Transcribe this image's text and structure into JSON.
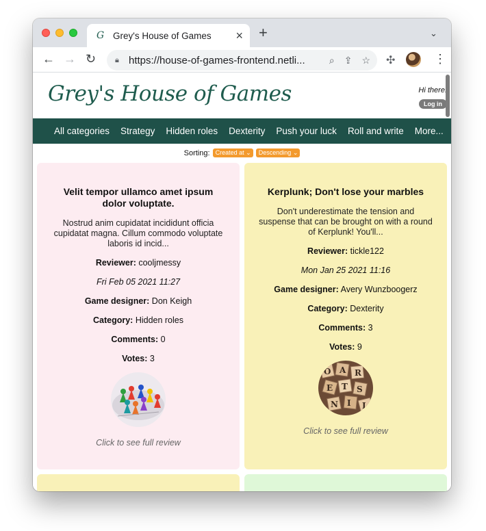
{
  "browser": {
    "tab_title": "Grey's House of Games",
    "url": "https://house-of-games-frontend.netli..."
  },
  "site": {
    "logo": "Grey's House of Games",
    "greeting": "Hi there!",
    "login_label": "Log in",
    "nav": [
      "All categories",
      "Strategy",
      "Hidden roles",
      "Dexterity",
      "Push your luck",
      "Roll and write",
      "More..."
    ],
    "sorting": {
      "label": "Sorting:",
      "sort_by": "Created at",
      "order": "Descending"
    }
  },
  "labels": {
    "reviewer": "Reviewer:",
    "designer": "Game designer:",
    "category": "Category:",
    "comments": "Comments:",
    "votes": "Votes:",
    "cta": "Click to see full review"
  },
  "reviews": [
    {
      "title": "Velit tempor ullamco amet ipsum dolor voluptate.",
      "body": "Nostrud anim cupidatat incididunt officia cupidatat magna. Cillum commodo voluptate laboris id incid...",
      "reviewer": "cooljmessy",
      "date": "Fri Feb 05 2021 11:27",
      "designer": "Don Keigh",
      "category": "Hidden roles",
      "comments": "0",
      "votes": "3",
      "background": "#fdecf1"
    },
    {
      "title": "Kerplunk; Don't lose your marbles",
      "body": "Don't underestimate the tension and suspense that can be brought on with a round of Kerplunk! You'll...",
      "reviewer": "tickle122",
      "date": "Mon Jan 25 2021 11:16",
      "designer": "Avery Wunzboogerz",
      "category": "Dexterity",
      "comments": "3",
      "votes": "9",
      "background": "#f9f1b8"
    }
  ],
  "colors": {
    "brand_green": "#1f5149",
    "accent_orange": "#f39a2d"
  }
}
